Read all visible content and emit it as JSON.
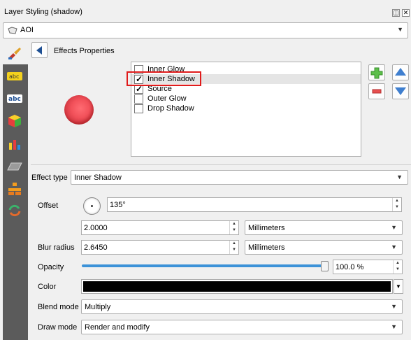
{
  "panel": {
    "title": "Layer Styling (shadow)",
    "float_icon": "◫",
    "close_icon": "✕"
  },
  "layer_combo": {
    "value": "AOI"
  },
  "effects": {
    "title": "Effects Properties",
    "items": [
      {
        "label": "Inner Glow",
        "checked": false
      },
      {
        "label": "Inner Shadow",
        "checked": true
      },
      {
        "label": "Source",
        "checked": true
      },
      {
        "label": "Outer Glow",
        "checked": false
      },
      {
        "label": "Drop Shadow",
        "checked": false
      }
    ],
    "selected_index": 1
  },
  "effect_type": {
    "label": "Effect type",
    "value": "Inner Shadow"
  },
  "offset": {
    "label": "Offset",
    "angle": "135°",
    "distance": "2.0000",
    "unit": "Millimeters"
  },
  "blur": {
    "label": "Blur radius",
    "value": "2.6450",
    "unit": "Millimeters"
  },
  "opacity": {
    "label": "Opacity",
    "value": "100.0 %",
    "level": 1.0
  },
  "color": {
    "label": "Color",
    "value": "#000000"
  },
  "blend_mode": {
    "label": "Blend mode",
    "value": "Multiply"
  },
  "draw_mode": {
    "label": "Draw mode",
    "value": "Render and modify"
  },
  "sidebar": {
    "icons": [
      "paintbrush-icon",
      "label-abc-icon",
      "label-abc-blue-icon",
      "3d-cube-icon",
      "diagram-icon",
      "mask-icon",
      "fields-icon",
      "history-icon"
    ]
  },
  "colors": {
    "accent": "#3c92d8",
    "highlight": "#e01b1b",
    "sidebar": "#5b5b5b"
  }
}
